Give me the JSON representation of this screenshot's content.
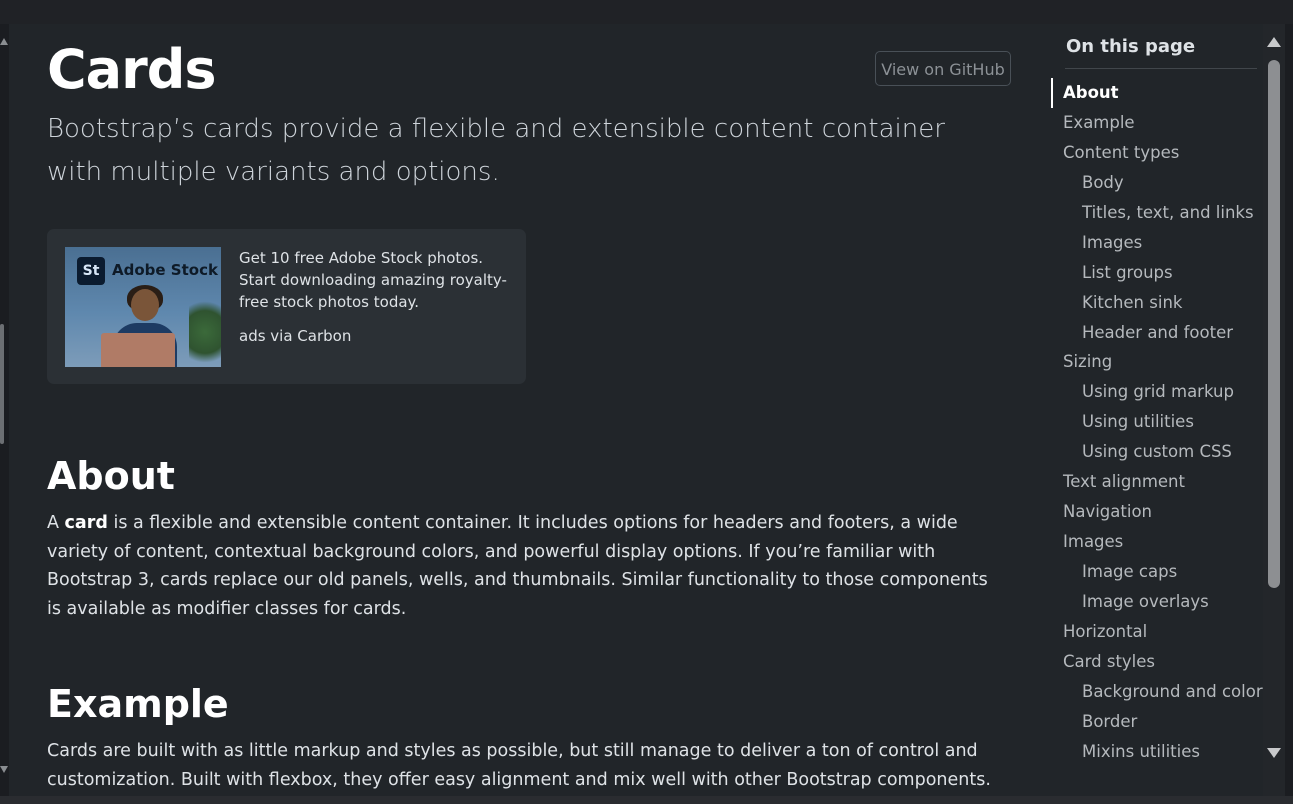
{
  "page": {
    "title": "Cards",
    "github_button": "View on GitHub",
    "lead": "Bootstrap’s cards provide a flexible and extensible content container with multiple variants and options."
  },
  "ad": {
    "logo_mark": "St",
    "logo_text": "Adobe Stock",
    "text": "Get 10 free Adobe Stock photos. Start downloading amazing royalty-free stock photos today.",
    "via": "ads via Carbon"
  },
  "about": {
    "heading": "About",
    "prefix": "A ",
    "bold": "card",
    "rest": " is a flexible and extensible content container. It includes options for headers and footers, a wide variety of content, contextual background colors, and powerful display options. If you’re familiar with Bootstrap 3, cards replace our old panels, wells, and thumbnails. Similar functionality to those components is available as modifier classes for cards."
  },
  "example": {
    "heading": "Example",
    "text": "Cards are built with as little markup and styles as possible, but still manage to deliver a ton of control and customization. Built with flexbox, they offer easy alignment and mix well with other Bootstrap components. They"
  },
  "toc": {
    "title": "On this page",
    "items": [
      {
        "label": "About",
        "level": 1,
        "active": true
      },
      {
        "label": "Example",
        "level": 1
      },
      {
        "label": "Content types",
        "level": 1
      },
      {
        "label": "Body",
        "level": 2
      },
      {
        "label": "Titles, text, and links",
        "level": 2
      },
      {
        "label": "Images",
        "level": 2
      },
      {
        "label": "List groups",
        "level": 2
      },
      {
        "label": "Kitchen sink",
        "level": 2
      },
      {
        "label": "Header and footer",
        "level": 2
      },
      {
        "label": "Sizing",
        "level": 1
      },
      {
        "label": "Using grid markup",
        "level": 2
      },
      {
        "label": "Using utilities",
        "level": 2
      },
      {
        "label": "Using custom CSS",
        "level": 2
      },
      {
        "label": "Text alignment",
        "level": 1
      },
      {
        "label": "Navigation",
        "level": 1
      },
      {
        "label": "Images",
        "level": 1
      },
      {
        "label": "Image caps",
        "level": 2
      },
      {
        "label": "Image overlays",
        "level": 2
      },
      {
        "label": "Horizontal",
        "level": 1
      },
      {
        "label": "Card styles",
        "level": 1
      },
      {
        "label": "Background and color",
        "level": 2
      },
      {
        "label": "Border",
        "level": 2
      },
      {
        "label": "Mixins utilities",
        "level": 2
      }
    ]
  },
  "colors": {
    "background": "#212529",
    "ad_background": "#2b3035",
    "active_toc": "#ffffff"
  }
}
